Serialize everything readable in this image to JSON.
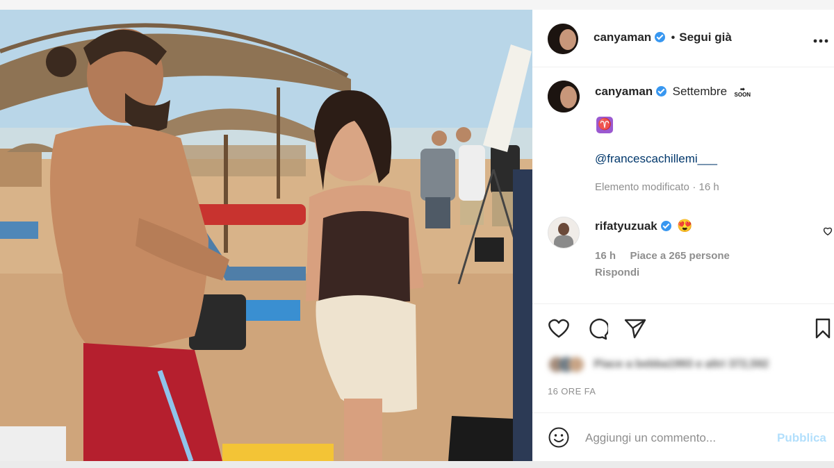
{
  "post": {
    "username": "canyaman",
    "separator": "•",
    "follow_status": "Segui già",
    "more_icon": "three-dots-horizontal-icon"
  },
  "caption": {
    "username": "canyaman",
    "text": "Settembre",
    "soon_label": "SOON",
    "emoji": "♈",
    "mention": "@francescachillemi___",
    "edited": "Elemento modificato",
    "age": "16 h"
  },
  "comment": {
    "username": "rifatyuzuak",
    "emoji": "😍",
    "age": "16 h",
    "likes": "Piace a 265 persone",
    "reply": "Rispondi"
  },
  "actions": {
    "like_icon": "heart-outline-icon",
    "comment_icon": "speech-bubble-icon",
    "share_icon": "paper-plane-icon",
    "save_icon": "bookmark-icon"
  },
  "likes_summary": "Piace a bebba1993 e altri 372,592",
  "timestamp": "16 ORE FA",
  "composer": {
    "placeholder": "Aggiungi un commento...",
    "publish": "Pubblica"
  },
  "colors": {
    "verified": "#3897f0",
    "publish": "#b2dffc",
    "text": "#262626",
    "muted": "#8e8e8e"
  }
}
